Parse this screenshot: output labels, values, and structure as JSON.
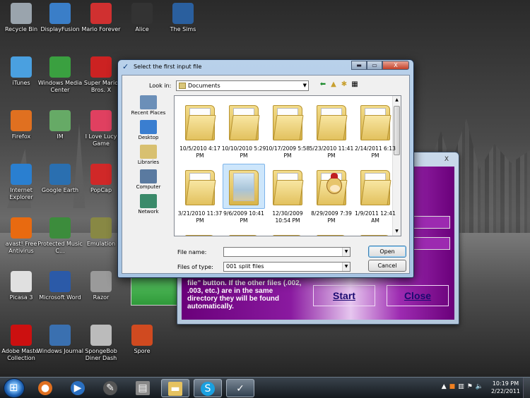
{
  "desktop_icons": [
    {
      "label": "Recycle Bin",
      "color": "#9aa4ad"
    },
    {
      "label": "DisplayFusion",
      "color": "#3a7ec8"
    },
    {
      "label": "Mario Forever",
      "color": "#d03030"
    },
    {
      "label": "Alice",
      "color": "#333333"
    },
    {
      "label": "The Sims",
      "color": "#2a5f9e"
    },
    {
      "label": "iTunes",
      "color": "#4aa0e0"
    },
    {
      "label": "Windows Media Center",
      "color": "#3aa040"
    },
    {
      "label": "Super Mario Bros. X",
      "color": "#cc2222"
    },
    {
      "label": "Firefox",
      "color": "#e07020"
    },
    {
      "label": "IM",
      "color": "#66aa66"
    },
    {
      "label": "I Love Lucy Game",
      "color": "#e04060"
    },
    {
      "label": "Internet Explorer",
      "color": "#2a7fd0"
    },
    {
      "label": "Google Earth",
      "color": "#2a6fb0"
    },
    {
      "label": "PopCap",
      "color": "#d02828"
    },
    {
      "label": "avast! Free Antivirus",
      "color": "#e86a10"
    },
    {
      "label": "Protected Music C...",
      "color": "#3c8c3c"
    },
    {
      "label": "Emulation",
      "color": "#888844"
    },
    {
      "label": "Picasa 3",
      "color": "#e0e0e0"
    },
    {
      "label": "Microsoft Word",
      "color": "#2b5aa8"
    },
    {
      "label": "Razor",
      "color": "#9a9a9a"
    },
    {
      "label": "Adobe Master Collection",
      "color": "#cc1010"
    },
    {
      "label": "Windows Journal",
      "color": "#3a70b0"
    },
    {
      "label": "SpongeBob Diner Dash",
      "color": "#bbbbbb"
    },
    {
      "label": "Spore",
      "color": "#d04a20"
    }
  ],
  "dialog": {
    "title": "Select the first input file",
    "look_in_label": "Look in:",
    "look_in_value": "Documents",
    "places": [
      "Recent Places",
      "Desktop",
      "Libraries",
      "Computer",
      "Network"
    ],
    "files": [
      {
        "name": "10/5/2010 4:17 PM",
        "kind": "folder"
      },
      {
        "name": "10/10/2010 5:29 PM",
        "kind": "folder"
      },
      {
        "name": "10/17/2009 5:58 PM",
        "kind": "folder"
      },
      {
        "name": "5/23/2010 11:41 PM",
        "kind": "folder"
      },
      {
        "name": "2/14/2011 6:13 PM",
        "kind": "folder"
      },
      {
        "name": "3/21/2010 11:37 PM",
        "kind": "folder"
      },
      {
        "name": "9/6/2009 10:41 PM",
        "kind": "photo",
        "selected": true
      },
      {
        "name": "12/30/2009 10:54 PM",
        "kind": "folder"
      },
      {
        "name": "8/29/2009 7:39 PM",
        "kind": "monkey"
      },
      {
        "name": "1/9/2011 12:41 AM",
        "kind": "folder"
      }
    ],
    "file_name_label": "File name:",
    "file_name_value": "",
    "file_type_label": "Files of type:",
    "file_type_value": "001 split files",
    "open_button": "Open",
    "cancel_button": "Cancel",
    "close_glyph": "X"
  },
  "bg_window": {
    "close_glyph": "X",
    "info_text": "file\" button. If the other files (.002, .003, etc.) are in the same directory they will be found automatically.",
    "start_button": "Start",
    "close_button": "Close"
  },
  "taskbar": {
    "time": "10:19 PM",
    "date": "2/22/2011"
  }
}
